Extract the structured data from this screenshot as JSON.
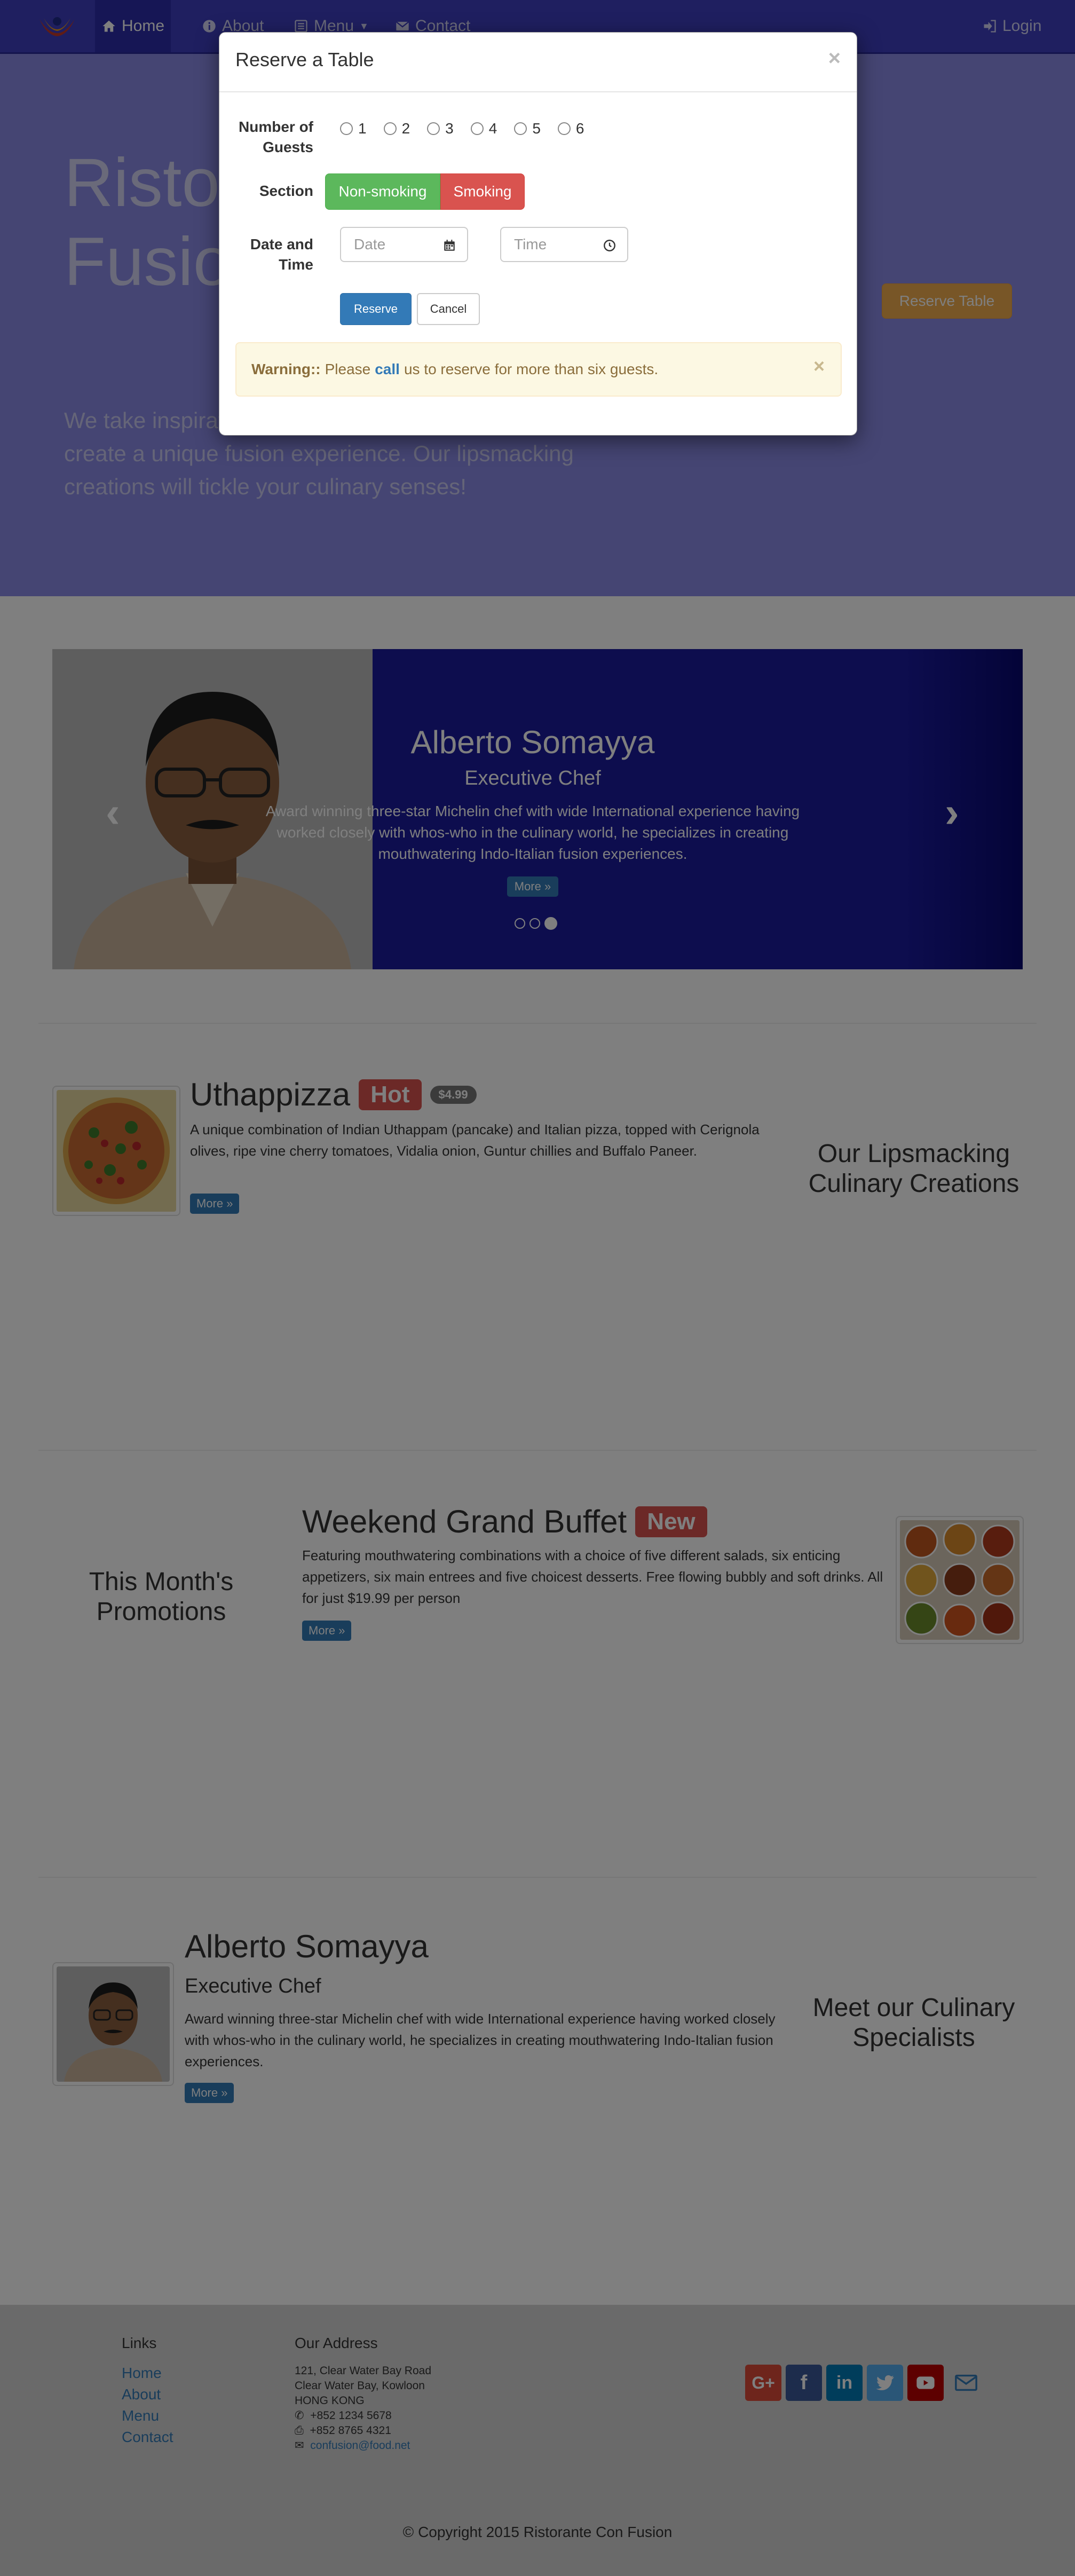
{
  "navbar": {
    "items": [
      {
        "label": "Home",
        "icon": "home-icon"
      },
      {
        "label": "About",
        "icon": "info-icon"
      },
      {
        "label": "Menu",
        "icon": "list-icon"
      },
      {
        "label": "Contact",
        "icon": "envelope-icon"
      }
    ],
    "login": "Login"
  },
  "jumbotron": {
    "title_line1": "Ristorante",
    "title_line2": "Fusion",
    "text": "We take inspiration from the World's best cuisines, and create a unique fusion experience. Our lipsmacking creations will tickle your culinary senses!",
    "reserve_button": "Reserve Table"
  },
  "carousel": {
    "name": "Alberto Somayya",
    "role": "Executive Chef",
    "description": "Award winning three-star Michelin chef with wide International experience having worked closely with whos-who in the culinary world, he specializes in creating mouthwatering Indo-Italian fusion experiences.",
    "more": "More »",
    "slide_count": 3,
    "active_slide": 3
  },
  "dish": {
    "name": "Uthappizza",
    "label": "Hot",
    "price": "$4.99",
    "description": "A unique combination of Indian Uthappam (pancake) and Italian pizza, topped with Cerignola olives, ripe vine cherry tomatoes, Vidalia onion, Guntur chillies and Buffalo Paneer.",
    "more": "More »",
    "side_title": "Our Lipsmacking Culinary Creations"
  },
  "promotion": {
    "name": "Weekend Grand Buffet",
    "label": "New",
    "description": "Featuring mouthwatering combinations with a choice of five different salads, six enticing appetizers, six main entrees and five choicest desserts. Free flowing bubbly and soft drinks. All for just $19.99 per person",
    "more": "More »",
    "side_title": "This Month's Promotions"
  },
  "leader": {
    "name": "Alberto Somayya",
    "role": "Executive Chef",
    "description": "Award winning three-star Michelin chef with wide International experience having worked closely with whos-who in the culinary world, he specializes in creating mouthwatering Indo-Italian fusion experiences.",
    "more": "More »",
    "side_title": "Meet our Culinary Specialists"
  },
  "footer": {
    "links_heading": "Links",
    "links": [
      "Home",
      "About",
      "Menu",
      "Contact"
    ],
    "address_heading": "Our Address",
    "address": [
      "121, Clear Water Bay Road",
      "Clear Water Bay, Kowloon",
      "HONG KONG"
    ],
    "phone": "+852 1234 5678",
    "fax": "+852 8765 4321",
    "email": "confusion@food.net",
    "social": [
      "google-plus-icon",
      "facebook-icon",
      "linkedin-icon",
      "twitter-icon",
      "youtube-icon",
      "mail-icon"
    ],
    "copyright": "© Copyright 2015 Ristorante Con Fusion"
  },
  "modal": {
    "title": "Reserve a Table",
    "guests_label": "Number of Guests",
    "guests_options": [
      "1",
      "2",
      "3",
      "4",
      "5",
      "6"
    ],
    "section_label": "Section",
    "section_options": [
      "Non-smoking",
      "Smoking"
    ],
    "datetime_label": "Date and Time",
    "date_placeholder": "Date",
    "time_placeholder": "Time",
    "reserve_button": "Reserve",
    "cancel_button": "Cancel",
    "warning_strong": "Warning::",
    "warning_pre": "Please",
    "warning_link": "call",
    "warning_post": "us to reserve for more than six guests."
  },
  "colors": {
    "navbar": "#3f3fc0",
    "jumbotron": "#8a8ae6",
    "carousel": "#1a1a9c",
    "reserve": "#f0ad4e",
    "success": "#5cb85c",
    "danger": "#d9534f",
    "primary": "#337ab7",
    "warning_bg": "#fcf8e3"
  }
}
